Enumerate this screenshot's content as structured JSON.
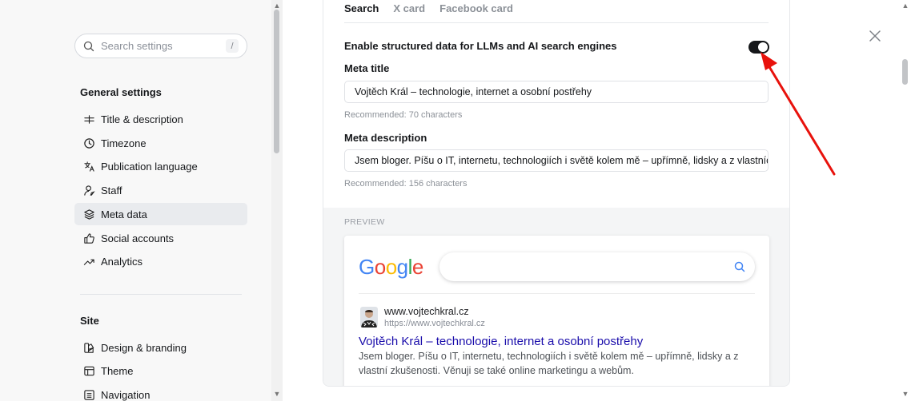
{
  "sidebar": {
    "search": {
      "placeholder": "Search settings",
      "shortcut": "/"
    },
    "general_title": "General settings",
    "general_items": [
      {
        "label": "Title & description",
        "icon": "title-icon"
      },
      {
        "label": "Timezone",
        "icon": "clock-icon"
      },
      {
        "label": "Publication language",
        "icon": "translate-icon"
      },
      {
        "label": "Staff",
        "icon": "staff-icon"
      },
      {
        "label": "Meta data",
        "icon": "layers-icon",
        "active": true
      },
      {
        "label": "Social accounts",
        "icon": "thumbs-up-icon"
      },
      {
        "label": "Analytics",
        "icon": "trend-icon"
      }
    ],
    "site_title": "Site",
    "site_items": [
      {
        "label": "Design & branding",
        "icon": "paint-icon"
      },
      {
        "label": "Theme",
        "icon": "theme-icon"
      },
      {
        "label": "Navigation",
        "icon": "navigation-icon"
      }
    ]
  },
  "tabs": [
    {
      "label": "Search",
      "active": true
    },
    {
      "label": "X card"
    },
    {
      "label": "Facebook card"
    }
  ],
  "structured_data": {
    "label": "Enable structured data for LLMs and AI search engines",
    "enabled": true
  },
  "meta_title": {
    "label": "Meta title",
    "value": "Vojtěch Král – technologie, internet a osobní postřehy",
    "hint": "Recommended: 70 characters"
  },
  "meta_description": {
    "label": "Meta description",
    "value": "Jsem bloger. Píšu o IT, internetu, technologiích i světě kolem mě – upřímně, lidsky a z vlastních zkušeností.",
    "hint": "Recommended: 156 characters"
  },
  "preview": {
    "label": "PREVIEW",
    "logo_text": "Google",
    "site_name": "www.vojtechkral.cz",
    "site_url": "https://www.vojtechkral.cz",
    "result_title": "Vojtěch Král – technologie, internet a osobní postřehy",
    "result_description": "Jsem bloger. Píšu o IT, internetu, technologiích i světě kolem mě – upřímně, lidsky a z vlastní zkušenosti. Věnuji se také online marketingu a webům."
  },
  "colors": {
    "toggle_on": "#15171a",
    "link_blue": "#1a0dab",
    "annotation_arrow": "#e8120c"
  }
}
